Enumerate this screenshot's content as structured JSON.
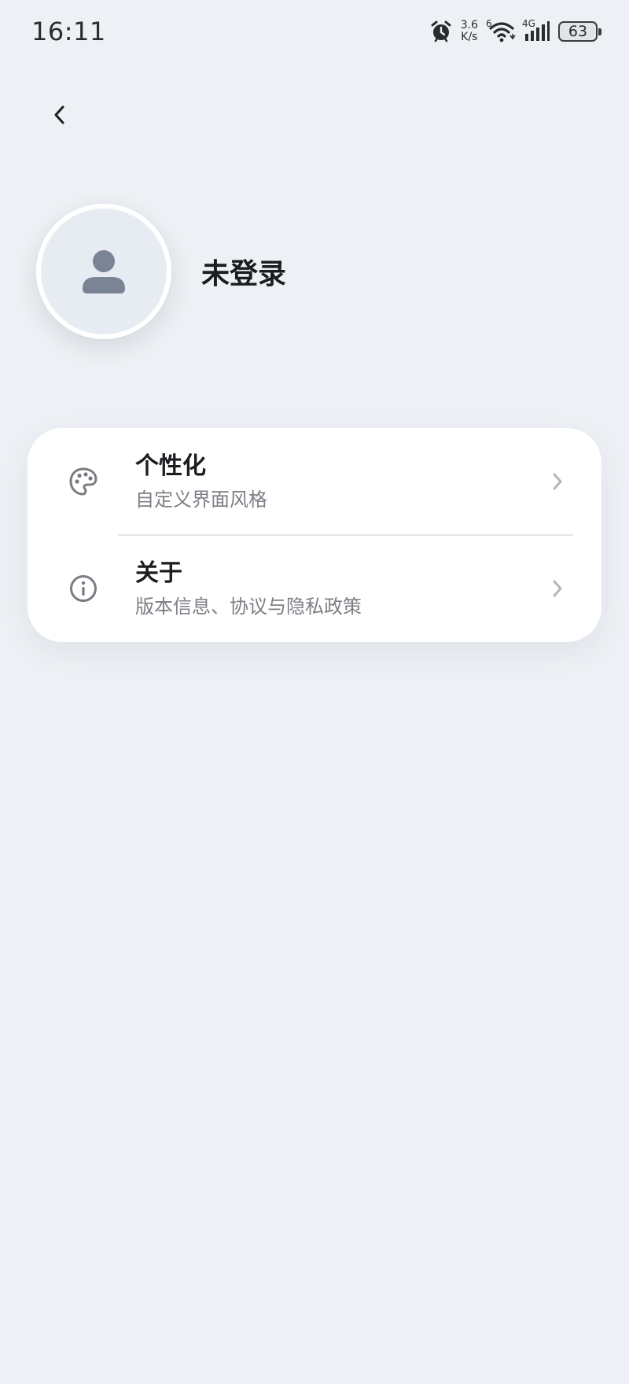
{
  "status_bar": {
    "time": "16:11",
    "alarm_icon": "alarm-icon",
    "net_speed_value": "3.6",
    "net_speed_unit": "K/s",
    "wifi_generation": "6",
    "wifi_icon": "wifi-icon",
    "cellular_label": "4G",
    "signal_icon": "signal-icon",
    "battery_level": "63"
  },
  "header": {
    "back_icon": "chevron-left-icon"
  },
  "profile": {
    "avatar_icon": "person-icon",
    "name": "未登录"
  },
  "menu": {
    "items": [
      {
        "icon": "palette-icon",
        "title": "个性化",
        "subtitle": "自定义界面风格",
        "chevron": "chevron-right-icon"
      },
      {
        "icon": "info-icon",
        "title": "关于",
        "subtitle": "版本信息、协议与隐私政策",
        "chevron": "chevron-right-icon"
      }
    ]
  },
  "colors": {
    "background": "#edf0f4",
    "card": "#ffffff",
    "text_primary": "#1c1d20",
    "text_secondary": "#7d7f85",
    "icon_gray": "#7a8494"
  }
}
